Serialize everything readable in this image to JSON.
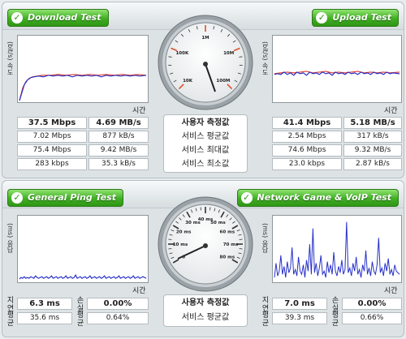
{
  "download": {
    "title": "Download Test",
    "ylabel": "(bit/s) 속도",
    "xlabel": "시간",
    "rows": [
      {
        "mbps": "37.5 Mbps",
        "mbs": "4.69 MB/s"
      },
      {
        "mbps": "7.02 Mbps",
        "mbs": "877 kB/s"
      },
      {
        "mbps": "75.4 Mbps",
        "mbs": "9.42 MB/s"
      },
      {
        "mbps": "283 kbps",
        "mbs": "35.3 kB/s"
      }
    ]
  },
  "upload": {
    "title": "Upload Test",
    "ylabel": "(bit/s) 속도",
    "xlabel": "시간",
    "rows": [
      {
        "mbps": "41.4 Mbps",
        "mbs": "5.18 MB/s"
      },
      {
        "mbps": "2.54 Mbps",
        "mbs": "317 kB/s"
      },
      {
        "mbps": "74.6 Mbps",
        "mbs": "9.32 MB/s"
      },
      {
        "mbps": "23.0 kbps",
        "mbs": "2.87 kB/s"
      }
    ]
  },
  "speed_labels": [
    "사용자 측정값",
    "서비스 평균값",
    "서비스 최대값",
    "서비스 최소값"
  ],
  "ping": {
    "title": "General Ping Test",
    "ylabel": "(ms) 응답",
    "xlabel": "시간",
    "side_top": "지연",
    "side_bottom": "평균",
    "loss_top": "손실",
    "loss_bottom": "평균",
    "user_latency": "6.3 ms",
    "avg_latency": "35.6 ms",
    "user_loss": "0.00%",
    "avg_loss": "0.64%"
  },
  "game": {
    "title": "Network Game & VoIP Test",
    "ylabel": "(ms) 응답",
    "xlabel": "시간",
    "side_top": "지연",
    "side_bottom": "평균",
    "loss_top": "손실",
    "loss_bottom": "평균",
    "user_latency": "7.0 ms",
    "avg_latency": "39.3 ms",
    "user_loss": "0.00%",
    "avg_loss": "0.66%"
  },
  "ping_labels": [
    "사용자 측정값",
    "서비스 평균값"
  ],
  "speed_gauge": {
    "labels": [
      "10K",
      "100K",
      "1M",
      "10M",
      "100M"
    ],
    "accent": "#e0502a"
  },
  "ping_gauge": {
    "labels": [
      "0",
      "10 ms",
      "20 ms",
      "30 ms",
      "40 ms",
      "50 ms",
      "60 ms",
      "70 ms",
      "80 ms"
    ]
  },
  "colors": {
    "badge_green": "#3fae22",
    "series_red": "#e33b2a",
    "series_blue": "#2630c8"
  }
}
